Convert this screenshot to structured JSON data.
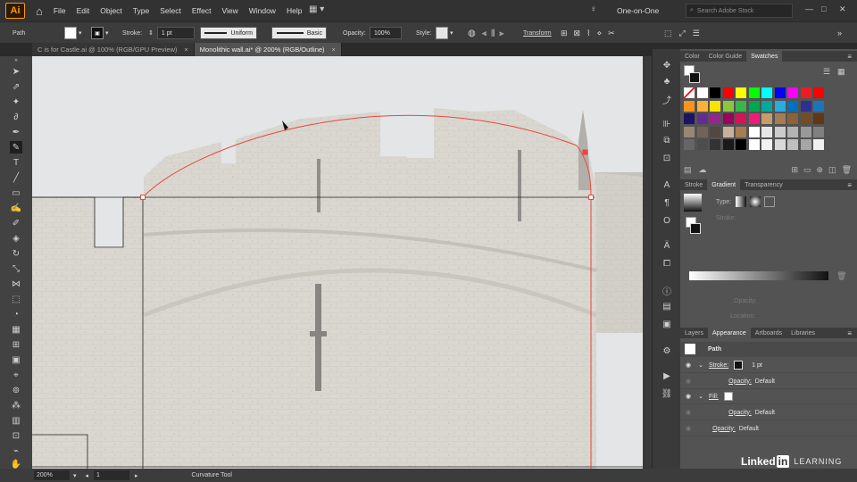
{
  "app": {
    "logo": "Ai",
    "home_icon": "home-icon"
  },
  "menu": [
    "File",
    "Edit",
    "Object",
    "Type",
    "Select",
    "Effect",
    "View",
    "Window",
    "Help"
  ],
  "workspace": {
    "name": "One-on-One",
    "search_placeholder": "Search Adobe Stock"
  },
  "control": {
    "selection_type": "Path",
    "stroke_label": "Stroke:",
    "stroke_weight": "1 pt",
    "profile": "Uniform",
    "brush": "Basic",
    "opacity_label": "Opacity:",
    "opacity": "100%",
    "style_label": "Style:",
    "transform": "Transform"
  },
  "tabs": [
    {
      "title": "C is for Castle.ai @ 100% (RGB/GPU Preview)"
    },
    {
      "title": "Monolithic wall.ai* @ 200% (RGB/Outline)"
    }
  ],
  "colors": {
    "path_red": "#e8473e",
    "accent": "#ff9a00"
  },
  "color_panel": {
    "tabs": [
      "Color",
      "Color Guide",
      "Swatches"
    ],
    "swatches_row1": [
      "#ffffff",
      "#ffffff",
      "#000000",
      "#ff0000",
      "#ffff00",
      "#00ff00",
      "#00ffff",
      "#0000ff",
      "#ff00ff",
      "#ed1c24",
      "#ff0000"
    ],
    "swatches_row2": [
      "#f7941d",
      "#fbb03b",
      "#f9e300",
      "#8cc63f",
      "#39b54a",
      "#00a651",
      "#00a99d",
      "#29abe2",
      "#0071bc",
      "#2e3192",
      "#1b75bc"
    ],
    "swatches_row3": [
      "#1b1464",
      "#662d91",
      "#93278f",
      "#9e005d",
      "#d4145a",
      "#ed1e79",
      "#c69c6d",
      "#a67c52",
      "#8c6239",
      "#754c24",
      "#603813"
    ],
    "swatches_row4": [
      "#998675",
      "#736357",
      "#534741",
      "#c7b299",
      "#a67c52",
      "#ffffff",
      "#e6e6e6",
      "#cccccc",
      "#b3b3b3",
      "#999999",
      "#808080"
    ],
    "swatches_row5": [
      "#666666",
      "#4d4d4d",
      "#333333",
      "#1a1a1a",
      "#000000",
      "#ffffff",
      "#f2f2f2",
      "#d9d9d9",
      "#bfbfbf",
      "#a6a6a6",
      "#f0f0f0"
    ]
  },
  "gradient_panel": {
    "tabs": [
      "Stroke",
      "Gradient",
      "Transparency"
    ],
    "type_label": "Type:",
    "stroke_label": "Stroke:",
    "opacity_label": "Opacity:",
    "location_label": "Location:"
  },
  "appearance_panel": {
    "tabs": [
      "Layers",
      "Appearance",
      "Artboards",
      "Libraries"
    ],
    "title": "Path",
    "rows": [
      {
        "label": "Stroke:",
        "value": "1 pt"
      },
      {
        "label": "Opacity:",
        "value": "Default"
      },
      {
        "label": "Fill:",
        "value": ""
      },
      {
        "label": "Opacity:",
        "value": "Default"
      },
      {
        "label": "Opacity:",
        "value": "Default"
      }
    ]
  },
  "status": {
    "zoom": "200%",
    "artboard": "1",
    "tool": "Curvature Tool"
  },
  "watermark": {
    "linkedin": "Linked",
    "in": "in",
    "learning": "LEARNING"
  }
}
